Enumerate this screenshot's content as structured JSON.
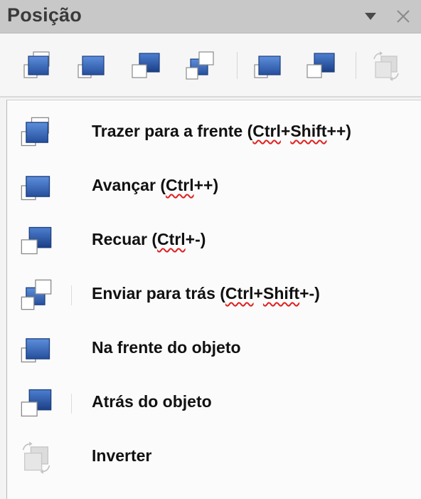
{
  "panel": {
    "title": "Posição"
  },
  "toolbar": {
    "buttons": [
      {
        "icon": "bring-to-front-icon"
      },
      {
        "icon": "forward-one-icon"
      },
      {
        "icon": "backward-one-icon"
      },
      {
        "icon": "send-to-back-icon"
      },
      {
        "icon": "in-front-of-object-icon"
      },
      {
        "icon": "behind-object-icon"
      },
      {
        "icon": "reverse-icon"
      }
    ]
  },
  "menu": {
    "items": [
      {
        "label_parts": [
          "Trazer para a frente (",
          "Ctrl",
          "+",
          "Shift",
          "++)"
        ]
      },
      {
        "label_parts": [
          "Avançar (",
          "Ctrl",
          "++)"
        ]
      },
      {
        "label_parts": [
          "Recuar (",
          "Ctrl",
          "+-)"
        ]
      },
      {
        "label_parts": [
          "Enviar para trás (",
          "Ctrl",
          "+",
          "Shift",
          "+-)"
        ]
      },
      {
        "label": "Na frente do objeto"
      },
      {
        "label": "Atrás do objeto"
      },
      {
        "label": "Inverter"
      }
    ]
  },
  "colors": {
    "title_bar": "#c8c8c8",
    "icon_blue": "#3f6fc0",
    "icon_blue_dark": "#1f4a96",
    "spell_underline": "#e02020"
  }
}
